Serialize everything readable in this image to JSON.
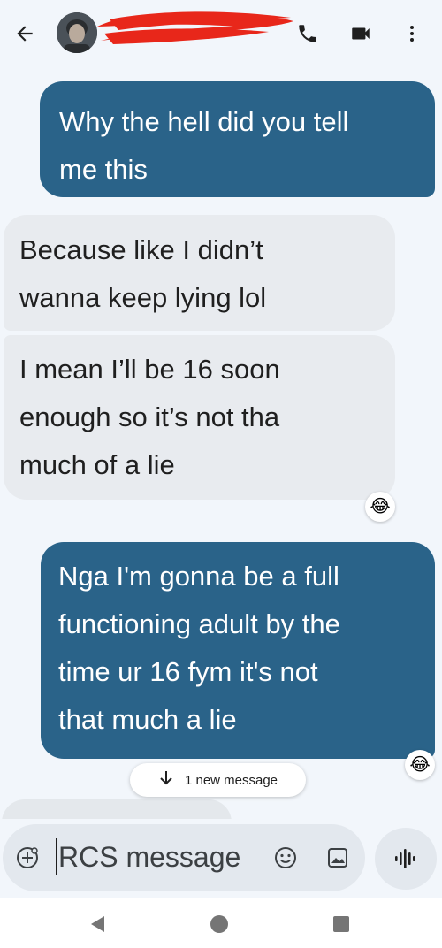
{
  "header": {
    "back_icon": "arrow-back-icon",
    "contact_avatar": "contact-avatar-photo",
    "contact_name_redacted": true,
    "call_icon": "phone-icon",
    "video_icon": "video-call-icon",
    "more_icon": "more-vertical-icon"
  },
  "messages": [
    {
      "direction": "sent",
      "lines": [
        "Why the hell did you tell",
        "me this"
      ]
    },
    {
      "direction": "received",
      "lines": [
        "Because like I didn’t",
        "wanna keep lying lol"
      ]
    },
    {
      "direction": "received",
      "lines": [
        "I mean I’ll be 16 soon",
        "enough so it’s not tha",
        "much of a lie"
      ],
      "reaction": "😂"
    },
    {
      "direction": "sent",
      "lines": [
        "Nga I'm gonna be a full",
        "functioning adult by the",
        "time ur 16 fym it's not",
        "that much a lie"
      ],
      "reaction": "😂"
    }
  ],
  "new_message_pill": {
    "label": "1 new message",
    "icon": "arrow-down-icon"
  },
  "composer": {
    "placeholder": "RCS message",
    "add_icon": "add-circle-icon",
    "emoji_icon": "emoji-icon",
    "image_icon": "gallery-icon",
    "voice_icon": "voice-waveform-icon"
  },
  "colors": {
    "sent_bubble": "#2a6389",
    "received_bubble": "#e8ebef",
    "background": "#f2f6fb",
    "redaction": "#e8271a"
  },
  "nav": {
    "back_icon": "nav-back-icon",
    "home_icon": "nav-home-icon",
    "recents_icon": "nav-recents-icon"
  }
}
